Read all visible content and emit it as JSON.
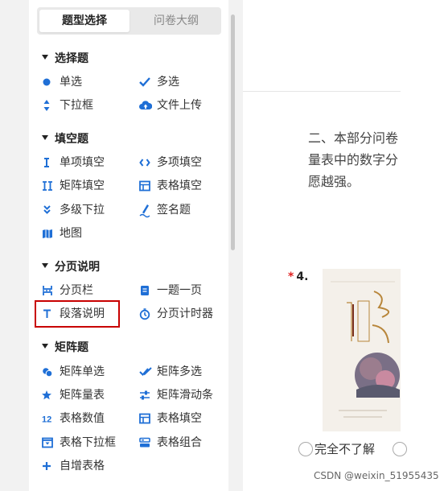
{
  "sidebar": {
    "tabs": [
      {
        "label": "题型选择",
        "active": true
      },
      {
        "label": "问卷大纲",
        "active": false
      }
    ],
    "sections": [
      {
        "title": "选择题",
        "items": [
          {
            "label": "单选",
            "icon": "radio-dot-icon"
          },
          {
            "label": "多选",
            "icon": "checkmark-icon"
          },
          {
            "label": "下拉框",
            "icon": "up-down-arrows-icon"
          },
          {
            "label": "文件上传",
            "icon": "cloud-upload-icon"
          }
        ]
      },
      {
        "title": "填空题",
        "items": [
          {
            "label": "单项填空",
            "icon": "text-cursor-icon"
          },
          {
            "label": "多项填空",
            "icon": "brackets-icon"
          },
          {
            "label": "矩阵填空",
            "icon": "double-cursor-icon"
          },
          {
            "label": "表格填空",
            "icon": "table-icon"
          },
          {
            "label": "多级下拉",
            "icon": "double-chevron-down-icon"
          },
          {
            "label": "签名题",
            "icon": "pen-signature-icon"
          },
          {
            "label": "地图",
            "icon": "map-icon"
          }
        ]
      },
      {
        "title": "分页说明",
        "items": [
          {
            "label": "分页栏",
            "icon": "page-break-icon"
          },
          {
            "label": "一题一页",
            "icon": "single-page-icon"
          },
          {
            "label": "段落说明",
            "icon": "paragraph-t-icon"
          },
          {
            "label": "分页计时器",
            "icon": "timer-icon"
          }
        ]
      },
      {
        "title": "矩阵题",
        "items": [
          {
            "label": "矩阵单选",
            "icon": "matrix-radio-icon"
          },
          {
            "label": "矩阵多选",
            "icon": "matrix-check-icon"
          },
          {
            "label": "矩阵量表",
            "icon": "star-scale-icon"
          },
          {
            "label": "矩阵滑动条",
            "icon": "sliders-icon"
          },
          {
            "label": "表格数值",
            "icon": "number-12-icon"
          },
          {
            "label": "表格填空",
            "icon": "table-icon"
          },
          {
            "label": "表格下拉框",
            "icon": "table-dropdown-icon"
          },
          {
            "label": "表格组合",
            "icon": "table-combo-icon"
          },
          {
            "label": "自增表格",
            "icon": "plus-icon"
          }
        ]
      }
    ]
  },
  "main": {
    "paragraph_lines": [
      "二、本部分问卷",
      "量表中的数字分",
      "愿越强。"
    ],
    "question_number": "4.",
    "required_mark": "*",
    "option_1": "完全不了解"
  },
  "watermark": "CSDN @weixin_51955435",
  "colors": {
    "accent": "#1a73e8",
    "highlight": "#c80000",
    "icon_blue": "#1f6fd6"
  }
}
